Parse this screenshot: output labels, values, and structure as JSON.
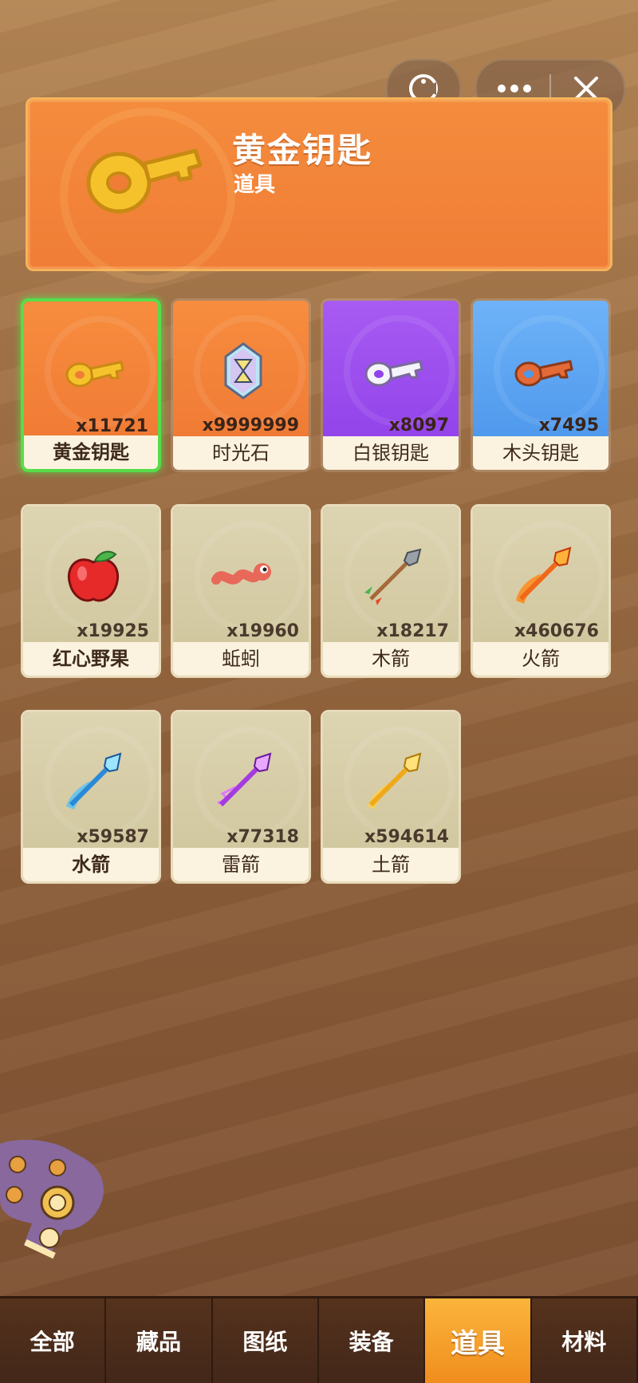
{
  "header": {
    "title": "黄金钥匙",
    "subtitle": "道具",
    "icon": "gold-key-icon"
  },
  "topButtons": [
    "pacman-icon",
    "more-icon",
    "close-icon"
  ],
  "items": [
    {
      "name": "黄金钥匙",
      "count": "x11721",
      "rarity": "orange",
      "icon": "gold-key-icon",
      "selected": true
    },
    {
      "name": "时光石",
      "count": "x9999999",
      "rarity": "orange",
      "icon": "hourglass-crystal-icon"
    },
    {
      "name": "白银钥匙",
      "count": "x8097",
      "rarity": "purple",
      "icon": "silver-key-icon"
    },
    {
      "name": "木头钥匙",
      "count": "x7495",
      "rarity": "blue",
      "icon": "wood-key-icon"
    },
    {
      "name": "红心野果",
      "count": "x19925",
      "rarity": "beige",
      "icon": "apple-icon"
    },
    {
      "name": "蚯蚓",
      "count": "x19960",
      "rarity": "beige",
      "icon": "worm-icon"
    },
    {
      "name": "木箭",
      "count": "x18217",
      "rarity": "beige",
      "icon": "wood-arrow-icon"
    },
    {
      "name": "火箭",
      "count": "x460676",
      "rarity": "beige",
      "icon": "fire-arrow-icon"
    },
    {
      "name": "水箭",
      "count": "x59587",
      "rarity": "beige",
      "icon": "water-arrow-icon"
    },
    {
      "name": "雷箭",
      "count": "x77318",
      "rarity": "beige",
      "icon": "thunder-arrow-icon"
    },
    {
      "name": "土箭",
      "count": "x594614",
      "rarity": "beige",
      "icon": "earth-arrow-icon"
    }
  ],
  "tabs": [
    {
      "label": "全部"
    },
    {
      "label": "藏品"
    },
    {
      "label": "图纸"
    },
    {
      "label": "装备"
    },
    {
      "label": "道具",
      "active": true
    },
    {
      "label": "材料"
    }
  ],
  "colors": {
    "orange": "#f07d36",
    "purple": "#9243ea",
    "blue": "#4e98ec",
    "beige": "#d6cca6",
    "selected_border": "#57dd4a",
    "active_tab": "#f5a02b"
  }
}
